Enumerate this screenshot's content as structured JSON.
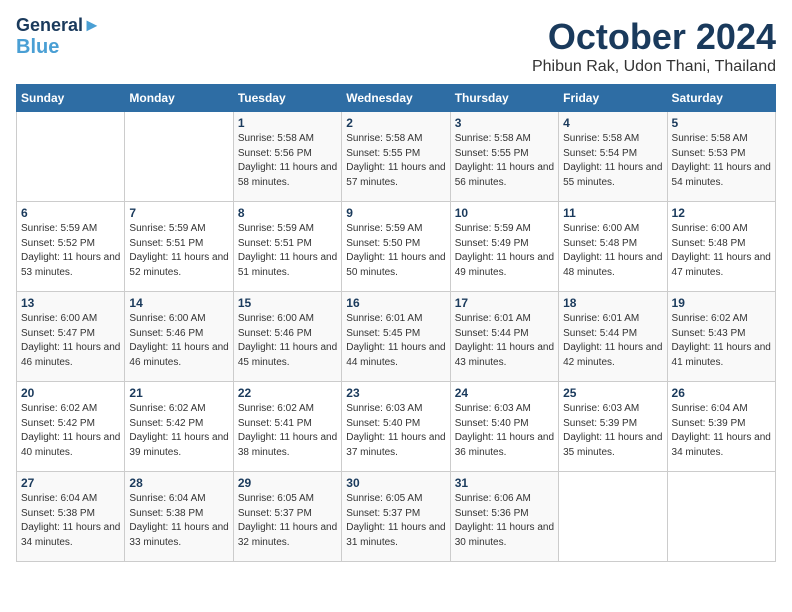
{
  "header": {
    "logo_line1": "General",
    "logo_line2": "Blue",
    "month": "October 2024",
    "location": "Phibun Rak, Udon Thani, Thailand"
  },
  "weekdays": [
    "Sunday",
    "Monday",
    "Tuesday",
    "Wednesday",
    "Thursday",
    "Friday",
    "Saturday"
  ],
  "days": [
    {
      "num": "",
      "sunrise": "",
      "sunset": "",
      "daylight": ""
    },
    {
      "num": "",
      "sunrise": "",
      "sunset": "",
      "daylight": ""
    },
    {
      "num": "1",
      "sunrise": "Sunrise: 5:58 AM",
      "sunset": "Sunset: 5:56 PM",
      "daylight": "Daylight: 11 hours and 58 minutes."
    },
    {
      "num": "2",
      "sunrise": "Sunrise: 5:58 AM",
      "sunset": "Sunset: 5:55 PM",
      "daylight": "Daylight: 11 hours and 57 minutes."
    },
    {
      "num": "3",
      "sunrise": "Sunrise: 5:58 AM",
      "sunset": "Sunset: 5:55 PM",
      "daylight": "Daylight: 11 hours and 56 minutes."
    },
    {
      "num": "4",
      "sunrise": "Sunrise: 5:58 AM",
      "sunset": "Sunset: 5:54 PM",
      "daylight": "Daylight: 11 hours and 55 minutes."
    },
    {
      "num": "5",
      "sunrise": "Sunrise: 5:58 AM",
      "sunset": "Sunset: 5:53 PM",
      "daylight": "Daylight: 11 hours and 54 minutes."
    },
    {
      "num": "6",
      "sunrise": "Sunrise: 5:59 AM",
      "sunset": "Sunset: 5:52 PM",
      "daylight": "Daylight: 11 hours and 53 minutes."
    },
    {
      "num": "7",
      "sunrise": "Sunrise: 5:59 AM",
      "sunset": "Sunset: 5:51 PM",
      "daylight": "Daylight: 11 hours and 52 minutes."
    },
    {
      "num": "8",
      "sunrise": "Sunrise: 5:59 AM",
      "sunset": "Sunset: 5:51 PM",
      "daylight": "Daylight: 11 hours and 51 minutes."
    },
    {
      "num": "9",
      "sunrise": "Sunrise: 5:59 AM",
      "sunset": "Sunset: 5:50 PM",
      "daylight": "Daylight: 11 hours and 50 minutes."
    },
    {
      "num": "10",
      "sunrise": "Sunrise: 5:59 AM",
      "sunset": "Sunset: 5:49 PM",
      "daylight": "Daylight: 11 hours and 49 minutes."
    },
    {
      "num": "11",
      "sunrise": "Sunrise: 6:00 AM",
      "sunset": "Sunset: 5:48 PM",
      "daylight": "Daylight: 11 hours and 48 minutes."
    },
    {
      "num": "12",
      "sunrise": "Sunrise: 6:00 AM",
      "sunset": "Sunset: 5:48 PM",
      "daylight": "Daylight: 11 hours and 47 minutes."
    },
    {
      "num": "13",
      "sunrise": "Sunrise: 6:00 AM",
      "sunset": "Sunset: 5:47 PM",
      "daylight": "Daylight: 11 hours and 46 minutes."
    },
    {
      "num": "14",
      "sunrise": "Sunrise: 6:00 AM",
      "sunset": "Sunset: 5:46 PM",
      "daylight": "Daylight: 11 hours and 46 minutes."
    },
    {
      "num": "15",
      "sunrise": "Sunrise: 6:00 AM",
      "sunset": "Sunset: 5:46 PM",
      "daylight": "Daylight: 11 hours and 45 minutes."
    },
    {
      "num": "16",
      "sunrise": "Sunrise: 6:01 AM",
      "sunset": "Sunset: 5:45 PM",
      "daylight": "Daylight: 11 hours and 44 minutes."
    },
    {
      "num": "17",
      "sunrise": "Sunrise: 6:01 AM",
      "sunset": "Sunset: 5:44 PM",
      "daylight": "Daylight: 11 hours and 43 minutes."
    },
    {
      "num": "18",
      "sunrise": "Sunrise: 6:01 AM",
      "sunset": "Sunset: 5:44 PM",
      "daylight": "Daylight: 11 hours and 42 minutes."
    },
    {
      "num": "19",
      "sunrise": "Sunrise: 6:02 AM",
      "sunset": "Sunset: 5:43 PM",
      "daylight": "Daylight: 11 hours and 41 minutes."
    },
    {
      "num": "20",
      "sunrise": "Sunrise: 6:02 AM",
      "sunset": "Sunset: 5:42 PM",
      "daylight": "Daylight: 11 hours and 40 minutes."
    },
    {
      "num": "21",
      "sunrise": "Sunrise: 6:02 AM",
      "sunset": "Sunset: 5:42 PM",
      "daylight": "Daylight: 11 hours and 39 minutes."
    },
    {
      "num": "22",
      "sunrise": "Sunrise: 6:02 AM",
      "sunset": "Sunset: 5:41 PM",
      "daylight": "Daylight: 11 hours and 38 minutes."
    },
    {
      "num": "23",
      "sunrise": "Sunrise: 6:03 AM",
      "sunset": "Sunset: 5:40 PM",
      "daylight": "Daylight: 11 hours and 37 minutes."
    },
    {
      "num": "24",
      "sunrise": "Sunrise: 6:03 AM",
      "sunset": "Sunset: 5:40 PM",
      "daylight": "Daylight: 11 hours and 36 minutes."
    },
    {
      "num": "25",
      "sunrise": "Sunrise: 6:03 AM",
      "sunset": "Sunset: 5:39 PM",
      "daylight": "Daylight: 11 hours and 35 minutes."
    },
    {
      "num": "26",
      "sunrise": "Sunrise: 6:04 AM",
      "sunset": "Sunset: 5:39 PM",
      "daylight": "Daylight: 11 hours and 34 minutes."
    },
    {
      "num": "27",
      "sunrise": "Sunrise: 6:04 AM",
      "sunset": "Sunset: 5:38 PM",
      "daylight": "Daylight: 11 hours and 34 minutes."
    },
    {
      "num": "28",
      "sunrise": "Sunrise: 6:04 AM",
      "sunset": "Sunset: 5:38 PM",
      "daylight": "Daylight: 11 hours and 33 minutes."
    },
    {
      "num": "29",
      "sunrise": "Sunrise: 6:05 AM",
      "sunset": "Sunset: 5:37 PM",
      "daylight": "Daylight: 11 hours and 32 minutes."
    },
    {
      "num": "30",
      "sunrise": "Sunrise: 6:05 AM",
      "sunset": "Sunset: 5:37 PM",
      "daylight": "Daylight: 11 hours and 31 minutes."
    },
    {
      "num": "31",
      "sunrise": "Sunrise: 6:06 AM",
      "sunset": "Sunset: 5:36 PM",
      "daylight": "Daylight: 11 hours and 30 minutes."
    },
    {
      "num": "",
      "sunrise": "",
      "sunset": "",
      "daylight": ""
    },
    {
      "num": "",
      "sunrise": "",
      "sunset": "",
      "daylight": ""
    }
  ]
}
